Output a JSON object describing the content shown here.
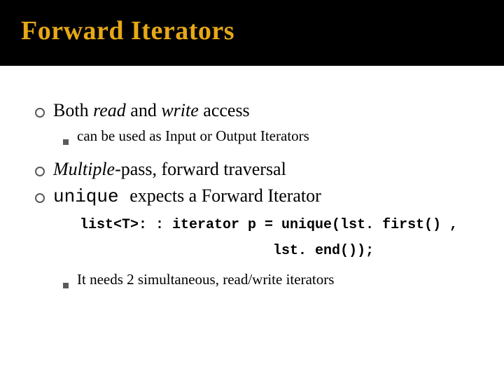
{
  "title": "Forward Iterators",
  "bullets": {
    "b1": {
      "both": "Both",
      "read": "read",
      "and": "and",
      "write": "write",
      "access": "access"
    },
    "b1_sub": "can be used as Input or Output Iterators",
    "b2": {
      "multiple": "Multiple",
      "pass": "-pass, forward traversal"
    },
    "b3": {
      "unique": "unique ",
      "rest": "expects a Forward Iterator"
    },
    "code_l1": "list<T>: : iterator p = unique(lst. first() ,",
    "code_l2": "                       lst. end());",
    "b3_sub": "It needs 2 simultaneous, read/write iterators"
  }
}
